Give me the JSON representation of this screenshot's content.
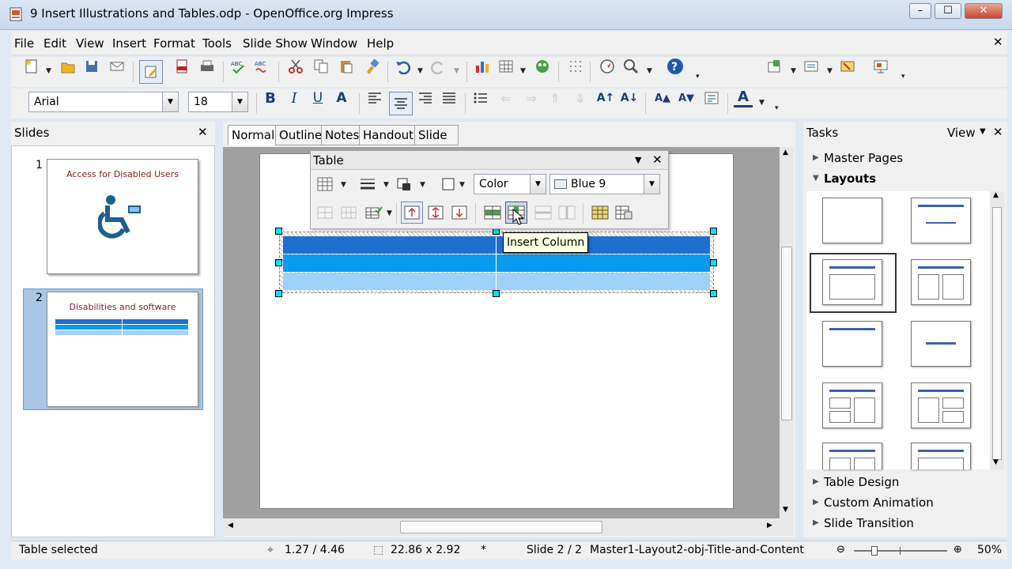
{
  "window": {
    "title": "9 Insert Illustrations and Tables.odp - OpenOffice.org Impress"
  },
  "menu": [
    "File",
    "Edit",
    "View",
    "Insert",
    "Format",
    "Tools",
    "Slide Show",
    "Window",
    "Help"
  ],
  "formatting": {
    "font_name": "Arial",
    "font_size": "18"
  },
  "slides_panel": {
    "title": "Slides",
    "slides": [
      {
        "number": "1",
        "title": "Access for Disabled Users"
      },
      {
        "number": "2",
        "title": "Disabilities and software"
      }
    ]
  },
  "view_tabs": [
    "Normal",
    "Outline",
    "Notes",
    "Handout",
    "Slide Sorter"
  ],
  "table_toolbar": {
    "title": "Table",
    "area_style": "Color",
    "fill_color": "Blue 9",
    "tooltip": "Insert Column"
  },
  "tasks_panel": {
    "title": "Tasks",
    "view_label": "View",
    "sections_top": [
      "Master Pages",
      "Layouts"
    ],
    "sections_bottom": [
      "Table Design",
      "Custom Animation",
      "Slide Transition"
    ]
  },
  "status_bar": {
    "message": "Table selected",
    "position": "1.27 / 4.46",
    "size": "22.86 x 2.92",
    "modified": "*",
    "slide": "Slide 2 / 2",
    "layout": "Master1-Layout2-obj-Title-and-Content",
    "zoom": "50%"
  },
  "colors": {
    "table_dark": "#1f6fd0",
    "table_mid": "#0a9af0",
    "table_light": "#9fd0fa",
    "slide_title": "#8b1a1a",
    "icon_blue": "#1f5f8b"
  }
}
